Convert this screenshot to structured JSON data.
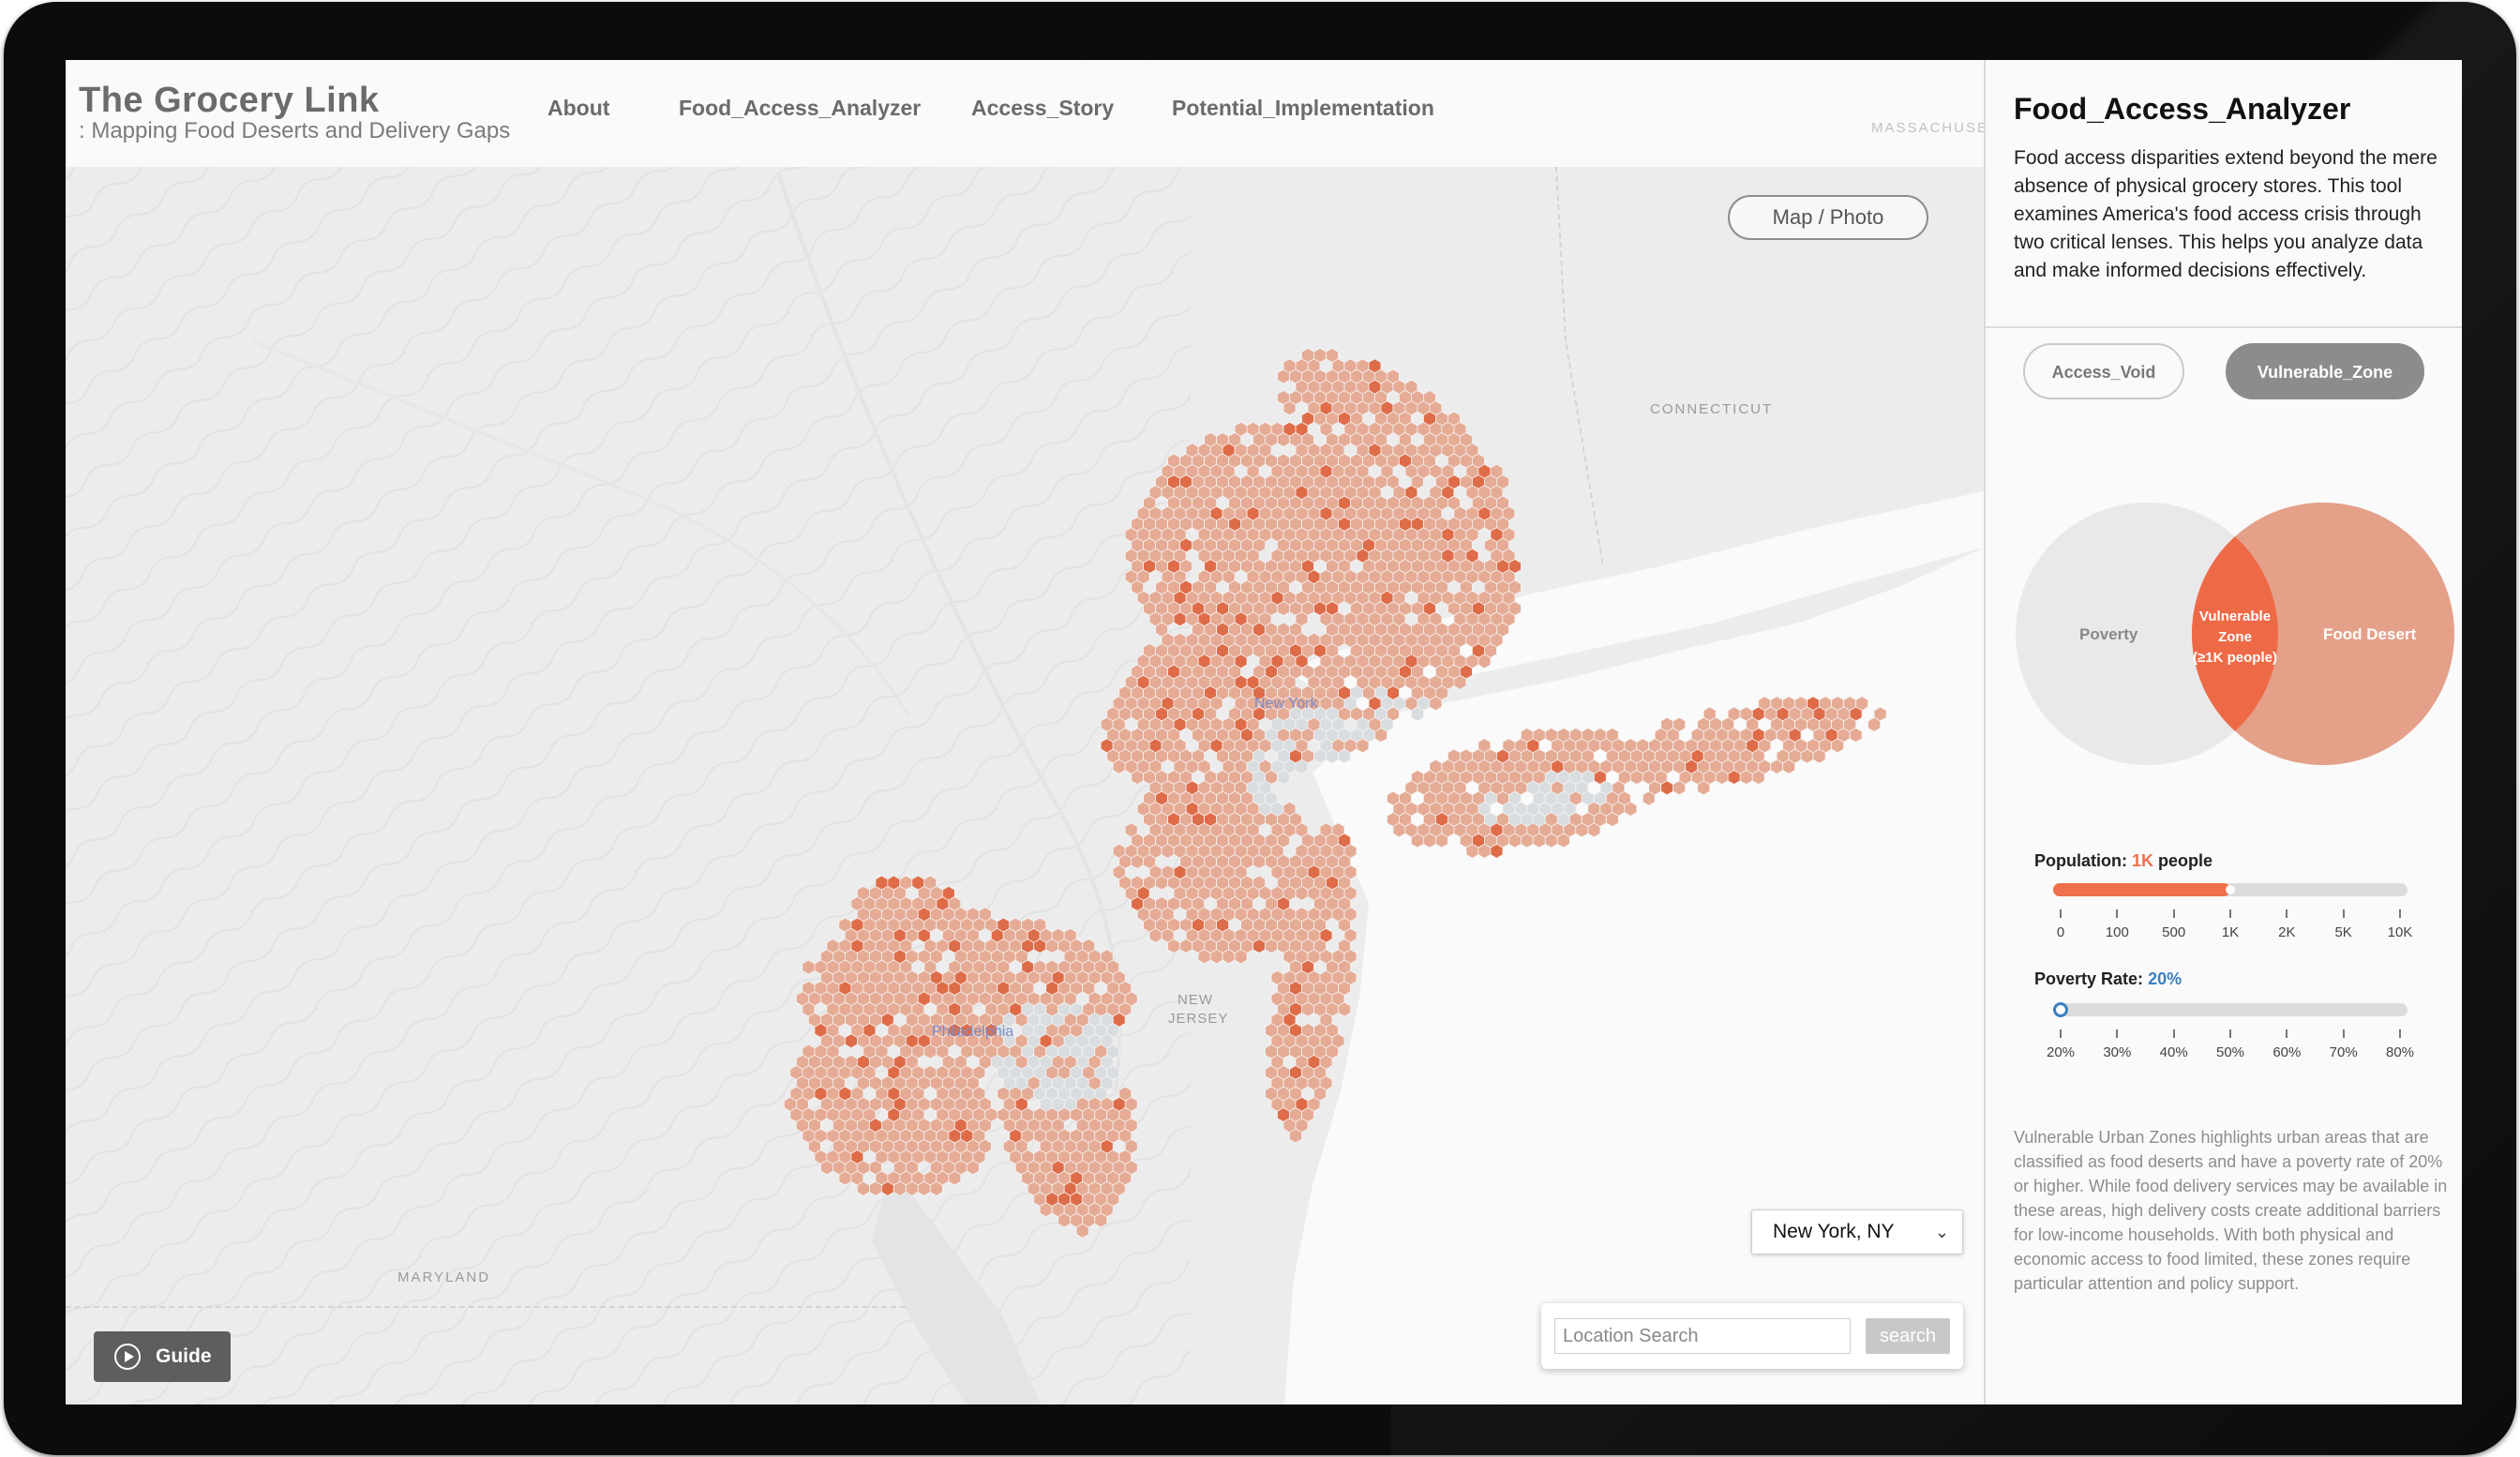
{
  "header": {
    "title": "The Grocery Link",
    "subtitle": ": Mapping Food Deserts and Delivery Gaps",
    "nav": [
      {
        "label": "About"
      },
      {
        "label": "Food_Access_Analyzer"
      },
      {
        "label": "Access_Story"
      },
      {
        "label": "Potential_Implementation"
      }
    ]
  },
  "map": {
    "toggle_label": "Map / Photo",
    "place_labels": {
      "connecticut": "CONNECTICUT",
      "massachusetts": "MASSACHUSETTS",
      "maryland": "MARYLAND",
      "new_jersey_1": "NEW",
      "new_jersey_2": "JERSEY",
      "new_york": "New York",
      "philadelphia": "Philadelphia"
    },
    "city_select": {
      "value": "New York, NY"
    },
    "search": {
      "placeholder": "Location Search",
      "button": "search"
    },
    "guide_label": "Guide",
    "colors": {
      "hex_light": "#e6ab95",
      "hex_dark": "#df6c48",
      "hex_gray": "#d9dde0"
    }
  },
  "panel": {
    "title": "Food_Access_Analyzer",
    "description": "Food access disparities extend beyond the mere absence of physical grocery stores. This tool examines America's food access crisis through two critical lenses. This helps you analyze data and make informed decisions effectively.",
    "modes": [
      {
        "label": "Access_Void",
        "active": false
      },
      {
        "label": "Vulnerable_Zone",
        "active": true
      }
    ],
    "venn": {
      "left_label": "Poverty",
      "right_label": "Food Desert",
      "center_lines": [
        "Vulnerable",
        "Zone",
        "(≥1K people)"
      ],
      "colors": {
        "left": "#e9e9eb",
        "right": "#e4a089",
        "center": "#ee6a47"
      }
    },
    "population": {
      "label": "Population:",
      "value": "1K",
      "unit": "people",
      "fraction": 0.5,
      "ticks": [
        "0",
        "100",
        "500",
        "1K",
        "2K",
        "5K",
        "10K"
      ]
    },
    "poverty": {
      "label": "Poverty Rate:",
      "value": "20%",
      "fraction": 0.0,
      "ticks": [
        "20%",
        "30%",
        "40%",
        "50%",
        "60%",
        "70%",
        "80%"
      ]
    },
    "footer": "Vulnerable Urban Zones highlights urban areas that are classified as food deserts and have a poverty rate of 20% or higher. While food delivery services may be available in these areas, high delivery costs create additional barriers for low-income households. With both physical and economic access to food limited, these zones require particular attention and policy support."
  }
}
